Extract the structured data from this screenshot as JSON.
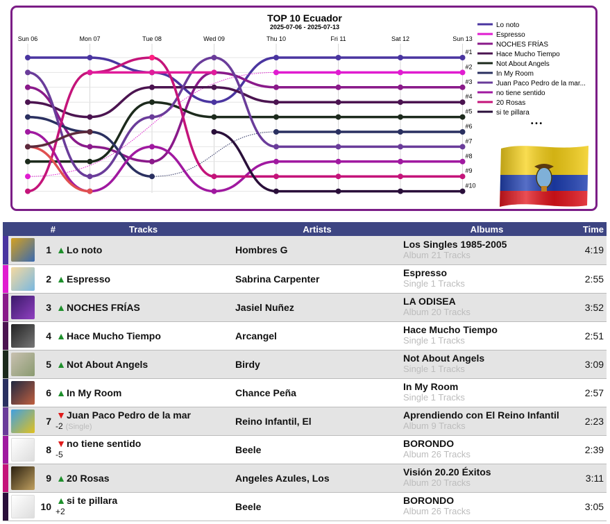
{
  "header": {
    "title": "TOP 10 Ecuador",
    "subtitle": "2025-07-06 - 2025-07-13"
  },
  "chart_data": {
    "type": "line",
    "title": "TOP 10 Ecuador",
    "subtitle": "2025-07-06 - 2025-07-13",
    "x": [
      "Sun 06",
      "Mon 07",
      "Tue 08",
      "Wed 09",
      "Thu 10",
      "Fri 11",
      "Sat 12",
      "Sun 13"
    ],
    "y_tick_labels": [
      "#1",
      "#2",
      "#3",
      "#4",
      "#5",
      "#6",
      "#7",
      "#8",
      "#9",
      "#10"
    ],
    "y_direction": "rank (1 at top)",
    "grid": true,
    "legend_position": "right",
    "legend_more": "• • •",
    "series": [
      {
        "name": "Lo noto",
        "color": "#4a35a0",
        "values": [
          1,
          1,
          2,
          4,
          1,
          1,
          1,
          1
        ]
      },
      {
        "name": "Espresso",
        "color": "#e01cd0",
        "values": [
          9,
          null,
          null,
          null,
          2,
          2,
          2,
          2
        ]
      },
      {
        "name": "NOCHES FRÍAS",
        "color": "#8a1a8a",
        "values": [
          3,
          7,
          8,
          2,
          3,
          3,
          3,
          3
        ]
      },
      {
        "name": "Hace Mucho Tiempo",
        "color": "#4b1450",
        "values": [
          4,
          5,
          3,
          3,
          4,
          4,
          4,
          4
        ]
      },
      {
        "name": "Not About Angels",
        "color": "#1c2a1c",
        "values": [
          8,
          8,
          4,
          5,
          5,
          5,
          5,
          5
        ]
      },
      {
        "name": "In My Room",
        "color": "#2a3060",
        "values": [
          5,
          6,
          9,
          null,
          6,
          6,
          6,
          6
        ]
      },
      {
        "name": "Juan Paco Pedro de la mar...",
        "color": "#6a3c9a",
        "values": [
          2,
          9,
          5,
          1,
          7,
          7,
          7,
          7
        ]
      },
      {
        "name": "no tiene sentido",
        "color": "#a019a0",
        "values": [
          6,
          10,
          7,
          10,
          8,
          8,
          8,
          8
        ]
      },
      {
        "name": "20 Rosas",
        "color": "#c4147a",
        "values": [
          10,
          2,
          1,
          9,
          9,
          9,
          9,
          9
        ]
      },
      {
        "name": "si te pillara",
        "color": "#2a0f3a",
        "values": [
          null,
          null,
          null,
          6,
          10,
          10,
          10,
          10
        ]
      },
      {
        "name": "",
        "color": "#e05050",
        "values": [
          7,
          10,
          null,
          null,
          null,
          null,
          null,
          null
        ]
      },
      {
        "name": "",
        "color": "#5c2a3c",
        "values": [
          7,
          6,
          null,
          null,
          null,
          null,
          null,
          null
        ]
      },
      {
        "name": "",
        "color": "#e01c9a",
        "values": [
          null,
          2,
          2,
          2,
          null,
          null,
          null,
          null
        ]
      },
      {
        "name": "",
        "color": "#ff2080",
        "values": [
          null,
          null,
          1,
          null,
          null,
          null,
          null,
          null
        ]
      }
    ]
  },
  "table": {
    "headers": [
      "#",
      "Tracks",
      "Artists",
      "Albums",
      "Time"
    ],
    "rows": [
      {
        "rank": "1",
        "trend": "up",
        "delta": "",
        "track": "Lo noto",
        "track_sub": "",
        "artist": "Hombres G",
        "album": "Los Singles 1985-2005",
        "album_sub": "Album 21 Tracks",
        "time": "4:19",
        "stripe": "#4a35a0",
        "art": [
          "#d4a020",
          "#3a6ab0"
        ]
      },
      {
        "rank": "2",
        "trend": "up",
        "delta": "",
        "track": "Espresso",
        "track_sub": "",
        "artist": "Sabrina Carpenter",
        "album": "Espresso",
        "album_sub": "Single 1 Tracks",
        "time": "2:55",
        "stripe": "#e01cd0",
        "art": [
          "#f4d9a0",
          "#7ab8e0"
        ]
      },
      {
        "rank": "3",
        "trend": "up",
        "delta": "",
        "track": "NOCHES FRÍAS",
        "track_sub": "",
        "artist": "Jasiel Nuñez",
        "album": "LA ODISEA",
        "album_sub": "Album 20 Tracks",
        "time": "3:52",
        "stripe": "#8a1a8a",
        "art": [
          "#3a1a6a",
          "#9040c0"
        ]
      },
      {
        "rank": "4",
        "trend": "up",
        "delta": "",
        "track": "Hace Mucho Tiempo",
        "track_sub": "",
        "artist": "Arcangel",
        "album": "Hace Mucho Tiempo",
        "album_sub": "Single 1 Tracks",
        "time": "2:51",
        "stripe": "#4b1450",
        "art": [
          "#222222",
          "#777777"
        ]
      },
      {
        "rank": "5",
        "trend": "up",
        "delta": "",
        "track": "Not About Angels",
        "track_sub": "",
        "artist": "Birdy",
        "album": "Not About Angels",
        "album_sub": "Single 1 Tracks",
        "time": "3:09",
        "stripe": "#1c2a1c",
        "art": [
          "#c8c0b0",
          "#8a9a70"
        ]
      },
      {
        "rank": "6",
        "trend": "up",
        "delta": "",
        "track": "In My Room",
        "track_sub": "",
        "artist": "Chance Peña",
        "album": "In My Room",
        "album_sub": "Single 1 Tracks",
        "time": "2:57",
        "stripe": "#2a3060",
        "art": [
          "#202840",
          "#c06040"
        ]
      },
      {
        "rank": "7",
        "trend": "down",
        "delta": "-2",
        "track": "Juan Paco Pedro de la mar",
        "track_sub": "(Single)",
        "artist": "Reino Infantil, El",
        "album": "Aprendiendo con El Reino Infantil",
        "album_sub": "Album 9 Tracks",
        "time": "2:23",
        "stripe": "#6a3c9a",
        "art": [
          "#40a0e0",
          "#e0c020"
        ]
      },
      {
        "rank": "8",
        "trend": "down",
        "delta": "-5",
        "track": "no tiene sentido",
        "track_sub": "",
        "artist": "Beele",
        "album": "BORONDO",
        "album_sub": "Album 26 Tracks",
        "time": "2:39",
        "stripe": "#a019a0",
        "art": [
          "#ffffff",
          "#dddddd"
        ]
      },
      {
        "rank": "9",
        "trend": "up",
        "delta": "",
        "track": "20 Rosas",
        "track_sub": "",
        "artist": "Angeles Azules, Los",
        "album": "Visión 20.20 Éxitos",
        "album_sub": "Album 20 Tracks",
        "time": "3:11",
        "stripe": "#c4147a",
        "art": [
          "#2a2010",
          "#c0a060"
        ]
      },
      {
        "rank": "10",
        "trend": "up",
        "delta": "+2",
        "track": "si te pillara",
        "track_sub": "",
        "artist": "Beele",
        "album": "BORONDO",
        "album_sub": "Album 26 Tracks",
        "time": "3:05",
        "stripe": "#2a0f3a",
        "art": [
          "#ffffff",
          "#dddddd"
        ]
      }
    ]
  }
}
